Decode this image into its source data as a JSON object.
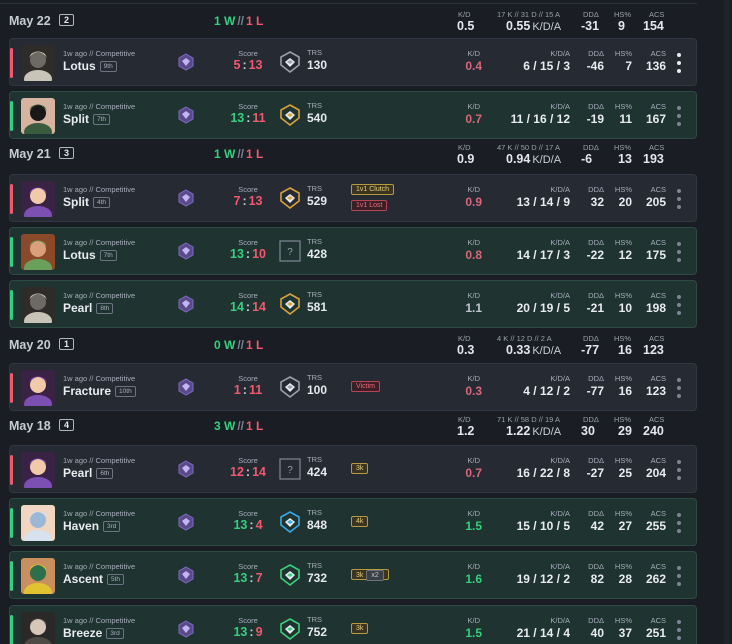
{
  "captions": {
    "kd": "K/D",
    "kda": "K/D/A",
    "dd": "DDΔ",
    "hs": "HS%",
    "acs": "ACS",
    "score": "Score",
    "trs": "TRS"
  },
  "colors": {
    "win": "#35d07f",
    "loss": "#ef5a6f",
    "background": "#1a1d23"
  },
  "days": [
    {
      "date": "May 22",
      "count": "2",
      "wins": "1 W",
      "sep": "//",
      "losses": "1 L",
      "kd": "0.5",
      "kda_detail": "17 K // 31 D // 15 A",
      "kda_ratio": "0.55",
      "kda_unit": "K/D/A",
      "dd": "-31",
      "hs": "9",
      "acs": "154"
    },
    {
      "date": "May 21",
      "count": "3",
      "wins": "1 W",
      "sep": "//",
      "losses": "1 L",
      "kd": "0.9",
      "kda_detail": "47 K // 50 D // 17 A",
      "kda_ratio": "0.94",
      "kda_unit": "K/D/A",
      "dd": "-6",
      "hs": "13",
      "acs": "193"
    },
    {
      "date": "May 20",
      "count": "1",
      "wins": "0 W",
      "sep": "//",
      "losses": "1 L",
      "kd": "0.3",
      "kda_detail": "4 K // 12 D // 2 A",
      "kda_ratio": "0.33",
      "kda_unit": "K/D/A",
      "dd": "-77",
      "hs": "16",
      "acs": "123"
    },
    {
      "date": "May 18",
      "count": "4",
      "wins": "3 W",
      "sep": "//",
      "losses": "1 L",
      "kd": "1.2",
      "kda_detail": "71 K // 58 D // 19 A",
      "kda_ratio": "1.22",
      "kda_unit": "K/D/A",
      "dd": "30",
      "hs": "29",
      "acs": "240"
    }
  ],
  "matches": [
    {
      "result": "loss",
      "agent": "cypher-agent-icon",
      "ago": "1w ago // Competitive",
      "map": "Lotus",
      "place": "9th",
      "score_a": "5",
      "score_b": "13",
      "trs_icon": "rank-grey-icon",
      "trs": "130",
      "kd": "0.4",
      "kda": "6 / 15 / 3",
      "dd": "-46",
      "hs": "7",
      "acs": "136",
      "tags": []
    },
    {
      "result": "win",
      "agent": "viper-agent-icon",
      "ago": "1w ago // Competitive",
      "map": "Split",
      "place": "7th",
      "score_a": "13",
      "score_b": "11",
      "trs_icon": "rank-gold-icon",
      "trs": "540",
      "kd": "0.7",
      "kda": "11 / 16 / 12",
      "dd": "-19",
      "hs": "11",
      "acs": "167",
      "tags": []
    },
    {
      "result": "loss",
      "agent": "reyna-agent-icon",
      "ago": "1w ago // Competitive",
      "map": "Split",
      "place": "4th",
      "score_a": "7",
      "score_b": "13",
      "trs_icon": "rank-gold-icon",
      "trs": "529",
      "kd": "0.9",
      "kda": "13 / 14 / 9",
      "dd": "32",
      "hs": "20",
      "acs": "205",
      "tags": [
        {
          "text": "1v1 Clutch",
          "style": "gold"
        },
        {
          "text": "1v1 Lost",
          "style": "red"
        }
      ]
    },
    {
      "result": "win",
      "agent": "skye-agent-icon",
      "ago": "1w ago // Competitive",
      "map": "Lotus",
      "place": "7th",
      "score_a": "13",
      "score_b": "10",
      "trs_icon": "unknown-rank-icon",
      "trs": "428",
      "kd": "0.8",
      "kda": "14 / 17 / 3",
      "dd": "-22",
      "hs": "12",
      "acs": "175",
      "tags": []
    },
    {
      "result": "draw",
      "agent": "cypher-agent-icon",
      "ago": "1w ago // Competitive",
      "map": "Pearl",
      "place": "8th",
      "score_a": "14",
      "score_b": "14",
      "trs_icon": "rank-gold-icon",
      "trs": "581",
      "kd": "1.1",
      "kda": "20 / 19 / 5",
      "dd": "-21",
      "hs": "10",
      "acs": "198",
      "tags": []
    },
    {
      "result": "loss",
      "agent": "reyna-agent-icon",
      "ago": "1w ago // Competitive",
      "map": "Fracture",
      "place": "10th",
      "score_a": "1",
      "score_b": "11",
      "trs_icon": "rank-grey-icon",
      "trs": "100",
      "kd": "0.3",
      "kda": "4 / 12 / 2",
      "dd": "-77",
      "hs": "16",
      "acs": "123",
      "tags": [
        {
          "text": "Victim",
          "style": "red"
        }
      ]
    },
    {
      "result": "loss",
      "agent": "reyna-agent-icon",
      "ago": "1w ago // Competitive",
      "map": "Pearl",
      "place": "6th",
      "score_a": "12",
      "score_b": "14",
      "trs_icon": "unknown-rank-icon",
      "trs": "424",
      "kd": "0.7",
      "kda": "16 / 22 / 8",
      "dd": "-27",
      "hs": "25",
      "acs": "204",
      "tags": [
        {
          "text": "3k",
          "style": "gold"
        }
      ]
    },
    {
      "result": "win",
      "agent": "jett-agent-icon",
      "ago": "1w ago // Competitive",
      "map": "Haven",
      "place": "3rd",
      "score_a": "13",
      "score_b": "4",
      "trs_icon": "rank-blue-icon",
      "trs": "848",
      "kd": "1.5",
      "kda": "15 / 10 / 5",
      "dd": "42",
      "hs": "27",
      "acs": "255",
      "tags": [
        {
          "text": "4k",
          "style": "gold"
        }
      ]
    },
    {
      "result": "win",
      "agent": "killjoy-agent-icon",
      "ago": "1w ago // Competitive",
      "map": "Ascent",
      "place": "5th",
      "score_a": "13",
      "score_b": "7",
      "trs_icon": "rank-green-icon",
      "trs": "732",
      "kd": "1.6",
      "kda": "19 / 12 / 2",
      "dd": "82",
      "hs": "28",
      "acs": "262",
      "tags": [
        {
          "text": "3k",
          "style": "gold",
          "extra": "x2"
        }
      ]
    },
    {
      "result": "win",
      "agent": "chamber-agent-icon",
      "ago": "1w ago // Competitive",
      "map": "Breeze",
      "place": "3rd",
      "score_a": "13",
      "score_b": "9",
      "trs_icon": "rank-green-icon",
      "trs": "752",
      "kd": "1.5",
      "kda": "21 / 14 / 4",
      "dd": "40",
      "hs": "37",
      "acs": "251",
      "tags": [
        {
          "text": "3k",
          "style": "gold"
        }
      ]
    }
  ]
}
